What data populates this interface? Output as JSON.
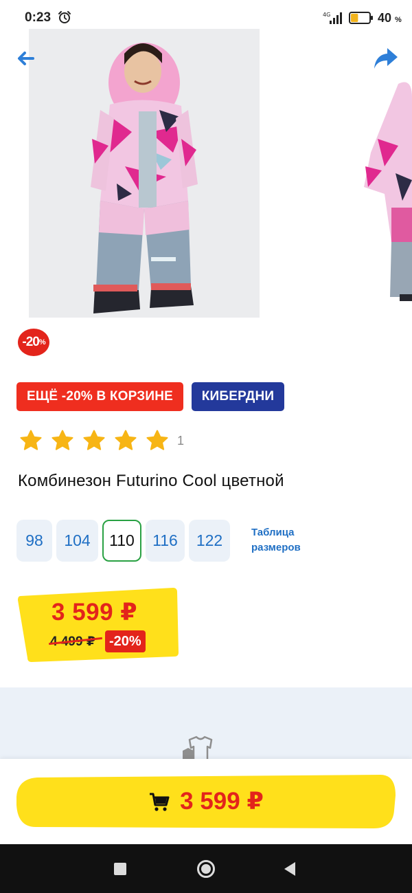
{
  "status_bar": {
    "time": "0:23",
    "network": "4G",
    "battery_percent": "40",
    "battery_unit": "%",
    "battery_level": 0.4
  },
  "header": {
    "back_icon": "arrow-left-icon",
    "share_icon": "share-arrow-icon"
  },
  "gallery": {
    "discount_badge_value": "-20",
    "discount_badge_unit": "%"
  },
  "promos": {
    "basket_promo": "ЕЩЁ -20% В КОРЗИНЕ",
    "cyberdays": "КИБЕРДНИ"
  },
  "rating": {
    "stars": 5,
    "max_stars": 5,
    "count": "1"
  },
  "product": {
    "title": "Комбинезон Futurino Cool цветной"
  },
  "sizes": {
    "items": [
      "98",
      "104",
      "110",
      "116",
      "122"
    ],
    "selected": "110",
    "table_link_line1": "Таблица",
    "table_link_line2": "размеров"
  },
  "price": {
    "current": "3 599 ₽",
    "old": "4 499 ₽",
    "discount": "-20%"
  },
  "cart": {
    "price": "3 599 ₽",
    "icon": "cart-icon"
  },
  "colors": {
    "accent_red": "#e3241b",
    "accent_blue": "#23399b",
    "link_blue": "#1f6fc4",
    "highlight_yellow": "#ffe01b",
    "selected_green": "#29a143",
    "star_yellow": "#f7b515"
  }
}
